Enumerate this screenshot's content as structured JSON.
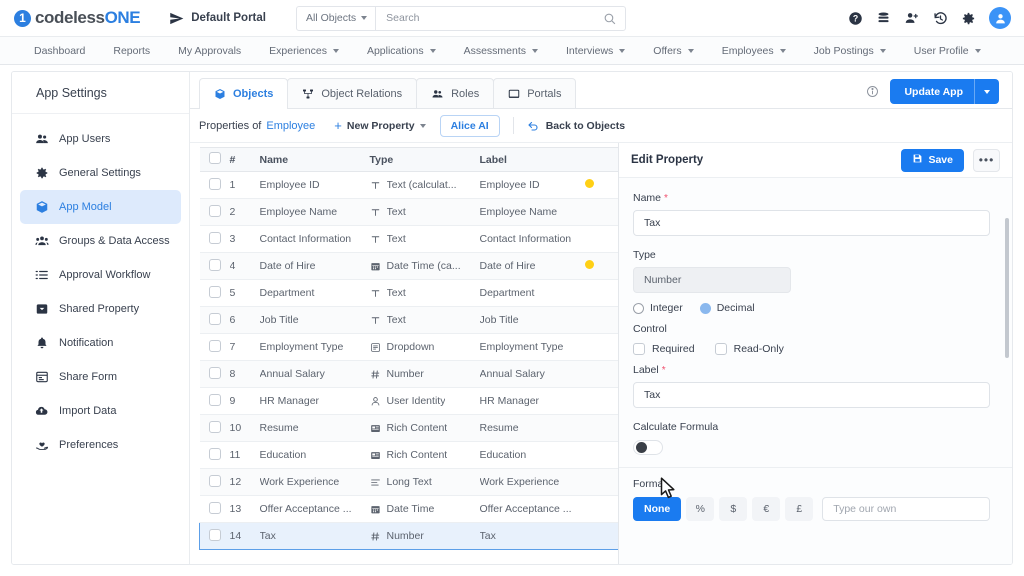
{
  "header": {
    "logo_prefix": "1",
    "logo_text_a": "codeless",
    "logo_text_b": "ONE",
    "portal_label": "Default Portal",
    "search": {
      "scope": "All Objects",
      "placeholder": "Search",
      "value": ""
    },
    "icons": [
      "help-icon",
      "database-icon",
      "add-user-icon",
      "history-icon",
      "gear-icon",
      "avatar"
    ]
  },
  "nav": {
    "items": [
      {
        "label": "Dashboard",
        "caret": false
      },
      {
        "label": "Reports",
        "caret": false
      },
      {
        "label": "My Approvals",
        "caret": false
      },
      {
        "label": "Experiences",
        "caret": true
      },
      {
        "label": "Applications",
        "caret": true
      },
      {
        "label": "Assessments",
        "caret": true
      },
      {
        "label": "Interviews",
        "caret": true
      },
      {
        "label": "Offers",
        "caret": true
      },
      {
        "label": "Employees",
        "caret": true
      },
      {
        "label": "Job Postings",
        "caret": true
      },
      {
        "label": "User Profile",
        "caret": true
      }
    ]
  },
  "sidebar": {
    "title": "App Settings",
    "items": [
      {
        "label": "App Users",
        "icon": "users-icon",
        "active": false
      },
      {
        "label": "General Settings",
        "icon": "gear-icon",
        "active": false
      },
      {
        "label": "App Model",
        "icon": "cube-icon",
        "active": true
      },
      {
        "label": "Groups & Data Access",
        "icon": "group-icon",
        "active": false
      },
      {
        "label": "Approval Workflow",
        "icon": "checklist-icon",
        "active": false
      },
      {
        "label": "Shared Property",
        "icon": "tag-icon",
        "active": false
      },
      {
        "label": "Notification",
        "icon": "bell-icon",
        "active": false
      },
      {
        "label": "Share Form",
        "icon": "form-icon",
        "active": false
      },
      {
        "label": "Import Data",
        "icon": "cloud-upload-icon",
        "active": false
      },
      {
        "label": "Preferences",
        "icon": "hand-heart-icon",
        "active": false
      }
    ]
  },
  "tabs": [
    {
      "label": "Objects",
      "icon": "cube-icon",
      "active": true
    },
    {
      "label": "Object Relations",
      "icon": "relations-icon",
      "active": false
    },
    {
      "label": "Roles",
      "icon": "users-icon",
      "active": false
    },
    {
      "label": "Portals",
      "icon": "window-icon",
      "active": false
    }
  ],
  "toolbar": {
    "info_icon": "info-icon",
    "update_label": "Update App",
    "properties_of": "Properties of",
    "object_name": "Employee",
    "new_property_label": "New Property",
    "alice_label": "Alice AI",
    "back_label": "Back to Objects"
  },
  "table": {
    "columns": [
      "",
      "#",
      "Name",
      "Type",
      "Label",
      ""
    ],
    "rows": [
      {
        "num": "1",
        "name": "Employee ID",
        "type": "Text (calculat...",
        "type_icon": "text-icon",
        "label": "Employee ID",
        "flag": true,
        "selected": false
      },
      {
        "num": "2",
        "name": "Employee Name",
        "type": "Text",
        "type_icon": "text-icon",
        "label": "Employee Name",
        "flag": false,
        "selected": false
      },
      {
        "num": "3",
        "name": "Contact Information",
        "type": "Text",
        "type_icon": "text-icon",
        "label": "Contact Information",
        "flag": false,
        "selected": false
      },
      {
        "num": "4",
        "name": "Date of Hire",
        "type": "Date Time (ca...",
        "type_icon": "calendar-icon",
        "label": "Date of Hire",
        "flag": true,
        "selected": false
      },
      {
        "num": "5",
        "name": "Department",
        "type": "Text",
        "type_icon": "text-icon",
        "label": "Department",
        "flag": false,
        "selected": false
      },
      {
        "num": "6",
        "name": "Job Title",
        "type": "Text",
        "type_icon": "text-icon",
        "label": "Job Title",
        "flag": false,
        "selected": false
      },
      {
        "num": "7",
        "name": "Employment Type",
        "type": "Dropdown",
        "type_icon": "dropdown-icon",
        "label": "Employment Type",
        "flag": false,
        "selected": false
      },
      {
        "num": "8",
        "name": "Annual Salary",
        "type": "Number",
        "type_icon": "number-icon",
        "label": "Annual Salary",
        "flag": false,
        "selected": false
      },
      {
        "num": "9",
        "name": "HR Manager",
        "type": "User Identity",
        "type_icon": "person-icon",
        "label": "HR Manager",
        "flag": false,
        "selected": false
      },
      {
        "num": "10",
        "name": "Resume",
        "type": "Rich Content",
        "type_icon": "rich-text-icon",
        "label": "Resume",
        "flag": false,
        "selected": false
      },
      {
        "num": "11",
        "name": "Education",
        "type": "Rich Content",
        "type_icon": "rich-text-icon",
        "label": "Education",
        "flag": false,
        "selected": false
      },
      {
        "num": "12",
        "name": "Work Experience",
        "type": "Long Text",
        "type_icon": "long-text-icon",
        "label": "Work Experience",
        "flag": false,
        "selected": false
      },
      {
        "num": "13",
        "name": "Offer Acceptance ...",
        "type": "Date Time",
        "type_icon": "calendar-icon",
        "label": "Offer Acceptance ...",
        "flag": false,
        "selected": false
      },
      {
        "num": "14",
        "name": "Tax",
        "type": "Number",
        "type_icon": "number-icon",
        "label": "Tax",
        "flag": false,
        "selected": true
      }
    ]
  },
  "panel": {
    "title": "Edit Property",
    "save_label": "Save",
    "more_label": "•••",
    "name_label": "Name",
    "name_value": "Tax",
    "type_label": "Type",
    "type_value": "Number",
    "radio_integer": "Integer",
    "radio_decimal": "Decimal",
    "radio_selected": "Decimal",
    "control_label": "Control",
    "cb_required": "Required",
    "cb_readonly": "Read-Only",
    "label_label": "Label",
    "label_value": "Tax",
    "calc_formula_label": "Calculate Formula",
    "calc_formula_on": false,
    "format_label": "Format",
    "format_options": [
      "None",
      "%",
      "$",
      "€",
      "£"
    ],
    "format_selected": "None",
    "format_custom_placeholder": "Type our own"
  },
  "colors": {
    "brand_blue": "#1a7bf0",
    "link_blue": "#2c7fe0",
    "flag_yellow": "#ffd015",
    "selected_row": "#e8f1fc",
    "sidebar_active": "#ddeafc"
  }
}
